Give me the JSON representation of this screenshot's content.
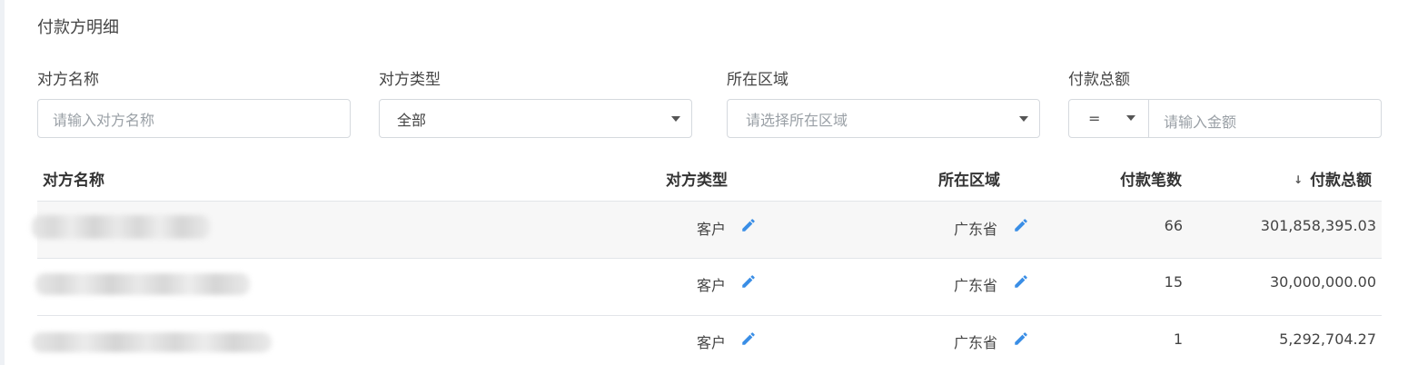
{
  "section_title": "付款方明细",
  "filters": {
    "name_label": "对方名称",
    "name_placeholder": "请输入对方名称",
    "type_label": "对方类型",
    "type_value": "全部",
    "region_label": "所在区域",
    "region_placeholder": "请选择所在区域",
    "amount_label": "付款总额",
    "amount_operator": "=",
    "amount_placeholder": "请输入金额"
  },
  "table": {
    "headers": {
      "name": "对方名称",
      "type": "对方类型",
      "region": "所在区域",
      "count": "付款笔数",
      "total": "付款总额"
    },
    "sort_indicator": "↓",
    "rows": [
      {
        "type": "客户",
        "region": "广东省",
        "count": "66",
        "total": "301,858,395.03"
      },
      {
        "type": "客户",
        "region": "广东省",
        "count": "15",
        "total": "30,000,000.00"
      },
      {
        "type": "客户",
        "region": "广东省",
        "count": "1",
        "total": "5,292,704.27"
      }
    ]
  },
  "colors": {
    "accent": "#3a8ee6",
    "border": "#d5d9de",
    "stripe": "#f7f7f7"
  },
  "icons": {
    "edit": "pencil-icon",
    "dropdown": "caret-down-icon",
    "sort": "arrow-down-icon"
  }
}
